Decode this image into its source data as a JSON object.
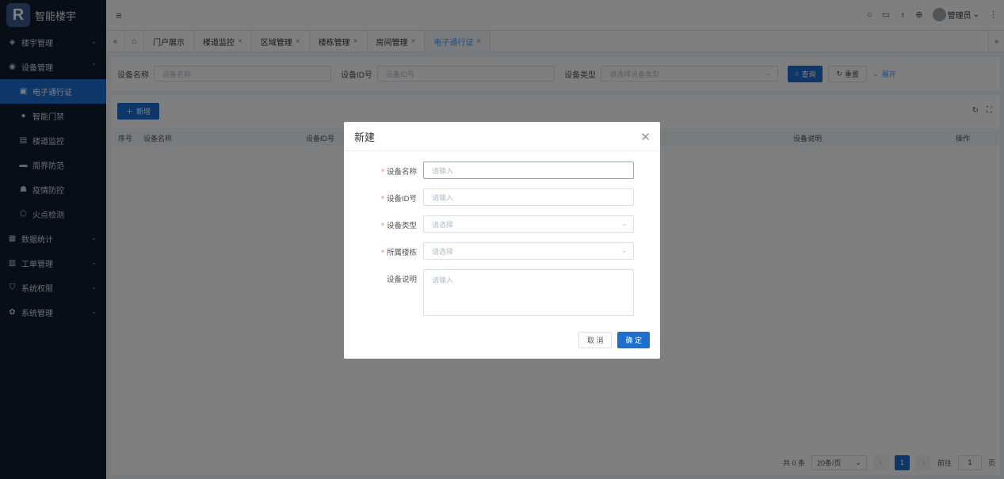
{
  "brand": {
    "logo_letter": "R",
    "title": "智能楼宇"
  },
  "sidebar": {
    "items": [
      {
        "label": "楼宇管理",
        "icon": "layers-icon",
        "arrow": "⌄"
      },
      {
        "label": "设备管理",
        "icon": "device-icon",
        "arrow": "⌃"
      },
      {
        "label": "电子通行证",
        "icon": "badge-icon",
        "sub": true,
        "active": true
      },
      {
        "label": "智能门禁",
        "icon": "location-pin-icon",
        "sub": true
      },
      {
        "label": "楼道监控",
        "icon": "monitor-icon",
        "sub": true
      },
      {
        "label": "周界防范",
        "icon": "wallet-icon",
        "sub": true
      },
      {
        "label": "疫情防控",
        "icon": "group-icon",
        "sub": true
      },
      {
        "label": "火点检测",
        "icon": "fire-icon",
        "sub": true
      },
      {
        "label": "数据统计",
        "icon": "chart-icon",
        "arrow": "⌄"
      },
      {
        "label": "工单管理",
        "icon": "clipboard-icon",
        "arrow": "⌄"
      },
      {
        "label": "系统权限",
        "icon": "shield-icon",
        "arrow": "⌄"
      },
      {
        "label": "系统管理",
        "icon": "gear-icon",
        "arrow": "⌄"
      }
    ]
  },
  "header": {
    "user": "管理员"
  },
  "tabs": [
    {
      "label": "门户展示",
      "closable": false
    },
    {
      "label": "楼道监控",
      "closable": true
    },
    {
      "label": "区域管理",
      "closable": true
    },
    {
      "label": "楼栋管理",
      "closable": true
    },
    {
      "label": "房间管理",
      "closable": true
    },
    {
      "label": "电子通行证",
      "closable": true,
      "active": true
    }
  ],
  "filter": {
    "name_label": "设备名称",
    "name_placeholder": "设备名称",
    "id_label": "设备ID号",
    "id_placeholder": "设备ID号",
    "type_label": "设备类型",
    "type_placeholder": "请选择设备类型",
    "search_label": "查询",
    "reset_label": "重置",
    "expand_label": "展开"
  },
  "toolbar": {
    "add_label": "新增"
  },
  "table": {
    "columns": [
      "序号",
      "设备名称",
      "设备ID号",
      "设备说明",
      "操作"
    ]
  },
  "pagination": {
    "total": "共 0 条",
    "page_size": "20条/页",
    "current": "1",
    "goto_label": "前往",
    "goto_value": "1",
    "page_unit": "页"
  },
  "modal": {
    "title": "新建",
    "fields": [
      {
        "label": "设备名称",
        "required": true,
        "placeholder": "请输入"
      },
      {
        "label": "设备ID号",
        "required": true,
        "placeholder": "请输入"
      },
      {
        "label": "设备类型",
        "required": true,
        "placeholder": "请选择"
      },
      {
        "label": "所属楼栋",
        "required": true,
        "placeholder": "请选择"
      },
      {
        "label": "设备说明",
        "required": false,
        "placeholder": "请输入"
      }
    ],
    "cancel_label": "取 消",
    "ok_label": "确 定"
  }
}
